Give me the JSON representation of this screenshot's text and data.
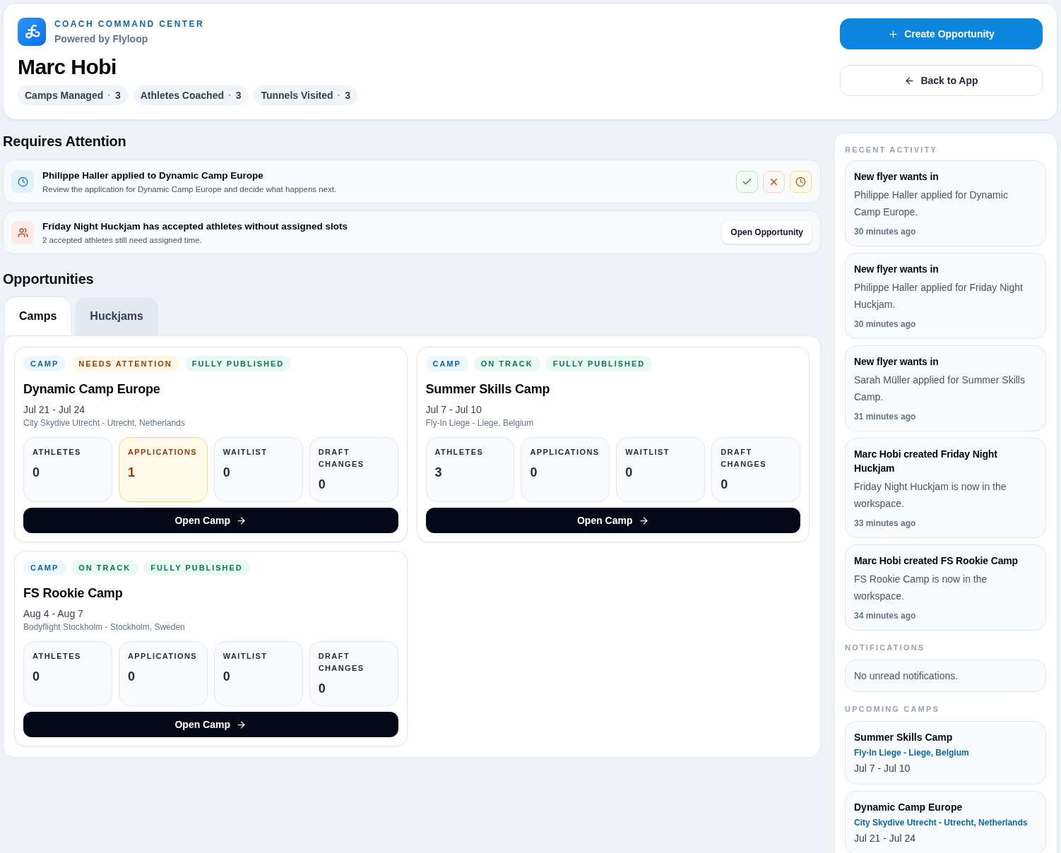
{
  "header": {
    "eyebrow": "COACH COMMAND CENTER",
    "subtitle": "Powered by Flyloop",
    "name": "Marc Hobi",
    "stats": [
      {
        "label": "Camps Managed",
        "separator": "·",
        "value": "3"
      },
      {
        "label": "Athletes Coached",
        "separator": "·",
        "value": "3"
      },
      {
        "label": "Tunnels Visited",
        "separator": "·",
        "value": "3"
      }
    ],
    "actions": [
      {
        "kind": "primary",
        "label": "Create Opportunity"
      },
      {
        "kind": "secondary",
        "label": "Back to App"
      }
    ]
  },
  "attention": {
    "title": "Requires Attention",
    "items": [
      {
        "kind": "application",
        "title": "Philippe Haller applied to Dynamic Camp Europe",
        "description": "Review the application for Dynamic Camp Europe and decide what happens next.",
        "actions": [
          {
            "kind": "approve"
          },
          {
            "kind": "reject"
          },
          {
            "kind": "defer"
          }
        ]
      },
      {
        "kind": "slots",
        "title": "Friday Night Huckjam has accepted athletes without assigned slots",
        "description": "2 accepted athletes still need assigned time.",
        "button": "Open Opportunity"
      }
    ]
  },
  "opportunities": {
    "title": "Opportunities",
    "tabs": [
      {
        "label": "Camps",
        "selected": true
      },
      {
        "label": "Huckjams",
        "selected": false
      }
    ],
    "cards": [
      {
        "badges": [
          {
            "kind": "category",
            "label": "CAMP"
          },
          {
            "kind": "warning",
            "label": "NEEDS ATTENTION"
          },
          {
            "kind": "success",
            "label": "FULLY PUBLISHED"
          }
        ],
        "title": "Dynamic Camp Europe",
        "dates": "Jul 21 - Jul 24",
        "location": "City Skydive Utrecht - Utrecht, Netherlands",
        "stats": [
          {
            "label": "ATHLETES",
            "value": "0",
            "highlighted": false
          },
          {
            "label": "APPLICATIONS",
            "value": "1",
            "highlighted": true
          },
          {
            "label": "WAITLIST",
            "value": "0",
            "highlighted": false
          },
          {
            "label": "DRAFT CHANGES",
            "value": "0",
            "highlighted": false
          }
        ],
        "button": "Open Camp"
      },
      {
        "badges": [
          {
            "kind": "category",
            "label": "CAMP"
          },
          {
            "kind": "success",
            "label": "ON TRACK"
          },
          {
            "kind": "success",
            "label": "FULLY PUBLISHED"
          }
        ],
        "title": "Summer Skills Camp",
        "dates": "Jul 7 - Jul 10",
        "location": "Fly-In Liege - Liege, Belgium",
        "stats": [
          {
            "label": "ATHLETES",
            "value": "3",
            "highlighted": false
          },
          {
            "label": "APPLICATIONS",
            "value": "0",
            "highlighted": false
          },
          {
            "label": "WAITLIST",
            "value": "0",
            "highlighted": false
          },
          {
            "label": "DRAFT CHANGES",
            "value": "0",
            "highlighted": false
          }
        ],
        "button": "Open Camp"
      },
      {
        "badges": [
          {
            "kind": "category",
            "label": "CAMP"
          },
          {
            "kind": "success",
            "label": "ON TRACK"
          },
          {
            "kind": "success",
            "label": "FULLY PUBLISHED"
          }
        ],
        "title": "FS Rookie Camp",
        "dates": "Aug 4 - Aug 7",
        "location": "Bodyflight Stockholm - Stockholm, Sweden",
        "stats": [
          {
            "label": "ATHLETES",
            "value": "0",
            "highlighted": false
          },
          {
            "label": "APPLICATIONS",
            "value": "0",
            "highlighted": false
          },
          {
            "label": "WAITLIST",
            "value": "0",
            "highlighted": false
          },
          {
            "label": "DRAFT CHANGES",
            "value": "0",
            "highlighted": false
          }
        ],
        "button": "Open Camp"
      }
    ]
  },
  "sidebar": {
    "recent_activity": {
      "title": "RECENT ACTIVITY",
      "items": [
        {
          "title": "New flyer wants in",
          "description": "Philippe Haller applied for Dynamic Camp Europe.",
          "time": "30 minutes ago"
        },
        {
          "title": "New flyer wants in",
          "description": "Philippe Haller applied for Friday Night Huckjam.",
          "time": "30 minutes ago"
        },
        {
          "title": "New flyer wants in",
          "description": "Sarah Müller applied for Summer Skills Camp.",
          "time": "31 minutes ago"
        },
        {
          "title": "Marc Hobi created Friday Night Huckjam",
          "description": "Friday Night Huckjam is now in the workspace.",
          "time": "33 minutes ago"
        },
        {
          "title": "Marc Hobi created FS Rookie Camp",
          "description": "FS Rookie Camp is now in the workspace.",
          "time": "34 minutes ago"
        }
      ]
    },
    "notifications": {
      "title": "NOTIFICATIONS",
      "message": "No unread notifications."
    },
    "upcoming_camps": {
      "title": "UPCOMING CAMPS",
      "items": [
        {
          "name": "Summer Skills Camp",
          "location": "Fly-In Liege - Liege, Belgium",
          "dates": "Jul 7 - Jul 10"
        },
        {
          "name": "Dynamic Camp Europe",
          "location": "City Skydive Utrecht - Utrecht, Netherlands",
          "dates": "Jul 21 - Jul 24"
        }
      ]
    }
  }
}
